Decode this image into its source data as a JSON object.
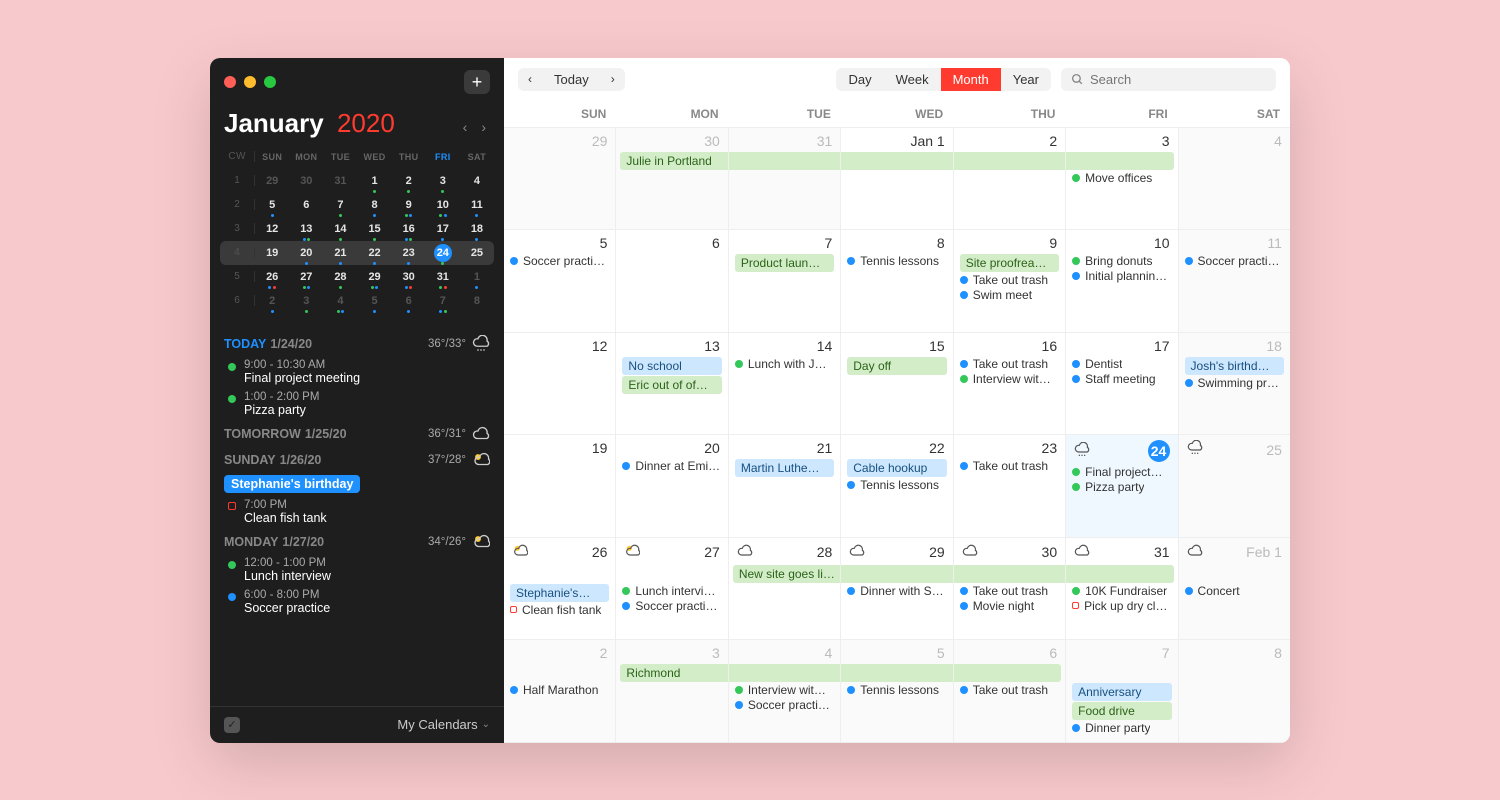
{
  "colors": {
    "green": "#34c759",
    "blue": "#1e90ff",
    "red": "#ff3b30"
  },
  "sidebar": {
    "month": "January",
    "year": "2020",
    "add_label": "+",
    "mini": {
      "head": [
        "CW",
        "SUN",
        "MON",
        "TUE",
        "WED",
        "THU",
        "FRI",
        "SAT"
      ],
      "today_col": 6,
      "rows": [
        {
          "cw": "1",
          "today": false,
          "days": [
            {
              "n": "29",
              "other": true
            },
            {
              "n": "30",
              "other": true
            },
            {
              "n": "31",
              "other": true
            },
            {
              "n": "1",
              "dots": [
                "green"
              ]
            },
            {
              "n": "2",
              "dots": [
                "green"
              ]
            },
            {
              "n": "3",
              "dots": [
                "green"
              ]
            },
            {
              "n": "4"
            }
          ]
        },
        {
          "cw": "2",
          "today": false,
          "days": [
            {
              "n": "5",
              "dots": [
                "blue"
              ]
            },
            {
              "n": "6"
            },
            {
              "n": "7",
              "dots": [
                "green"
              ]
            },
            {
              "n": "8",
              "dots": [
                "blue"
              ]
            },
            {
              "n": "9",
              "dots": [
                "green",
                "blue"
              ]
            },
            {
              "n": "10",
              "dots": [
                "green",
                "blue"
              ]
            },
            {
              "n": "11",
              "dots": [
                "blue"
              ]
            }
          ]
        },
        {
          "cw": "3",
          "today": false,
          "days": [
            {
              "n": "12"
            },
            {
              "n": "13",
              "dots": [
                "blue",
                "green"
              ]
            },
            {
              "n": "14",
              "dots": [
                "green"
              ]
            },
            {
              "n": "15",
              "dots": [
                "green"
              ]
            },
            {
              "n": "16",
              "dots": [
                "blue",
                "green"
              ]
            },
            {
              "n": "17",
              "dots": [
                "blue"
              ]
            },
            {
              "n": "18",
              "dots": [
                "blue"
              ]
            }
          ]
        },
        {
          "cw": "4",
          "today": true,
          "days": [
            {
              "n": "19"
            },
            {
              "n": "20",
              "dots": [
                "blue"
              ]
            },
            {
              "n": "21",
              "dots": [
                "blue"
              ]
            },
            {
              "n": "22",
              "dots": [
                "blue"
              ]
            },
            {
              "n": "23",
              "dots": [
                "blue"
              ]
            },
            {
              "n": "24",
              "today": true,
              "dots": [
                "green"
              ]
            },
            {
              "n": "25"
            }
          ]
        },
        {
          "cw": "5",
          "today": false,
          "days": [
            {
              "n": "26",
              "dots": [
                "blue",
                "red"
              ]
            },
            {
              "n": "27",
              "dots": [
                "green",
                "blue"
              ]
            },
            {
              "n": "28",
              "dots": [
                "green"
              ]
            },
            {
              "n": "29",
              "dots": [
                "green",
                "blue"
              ]
            },
            {
              "n": "30",
              "dots": [
                "blue",
                "red"
              ]
            },
            {
              "n": "31",
              "dots": [
                "green",
                "red"
              ]
            },
            {
              "n": "1",
              "other": true,
              "dots": [
                "blue"
              ]
            }
          ]
        },
        {
          "cw": "6",
          "today": false,
          "days": [
            {
              "n": "2",
              "other": true,
              "dots": [
                "blue"
              ]
            },
            {
              "n": "3",
              "other": true,
              "dots": [
                "green"
              ]
            },
            {
              "n": "4",
              "other": true,
              "dots": [
                "green",
                "blue"
              ]
            },
            {
              "n": "5",
              "other": true,
              "dots": [
                "blue"
              ]
            },
            {
              "n": "6",
              "other": true,
              "dots": [
                "blue"
              ]
            },
            {
              "n": "7",
              "other": true,
              "dots": [
                "blue",
                "green"
              ]
            },
            {
              "n": "8",
              "other": true
            }
          ]
        }
      ]
    },
    "agenda": [
      {
        "label": "TODAY",
        "date": "1/24/20",
        "today": true,
        "temp": "36°/33°",
        "wx": "rain",
        "items": [
          {
            "kind": "dot",
            "color": "green",
            "time": "9:00 - 10:30 AM",
            "title": "Final project meeting"
          },
          {
            "kind": "dot",
            "color": "green",
            "time": "1:00 - 2:00 PM",
            "title": "Pizza party"
          }
        ]
      },
      {
        "label": "TOMORROW",
        "date": "1/25/20",
        "temp": "36°/31°",
        "wx": "cloud",
        "items": []
      },
      {
        "label": "SUNDAY",
        "date": "1/26/20",
        "temp": "37°/28°",
        "wx": "partly",
        "items": [
          {
            "kind": "chip",
            "color": "blue",
            "title": "Stephanie's birthday"
          },
          {
            "kind": "sq",
            "color": "red",
            "time": "7:00 PM",
            "title": "Clean fish tank"
          }
        ]
      },
      {
        "label": "MONDAY",
        "date": "1/27/20",
        "temp": "34°/26°",
        "wx": "partly",
        "items": [
          {
            "kind": "dot",
            "color": "green",
            "time": "12:00 - 1:00 PM",
            "title": "Lunch interview"
          },
          {
            "kind": "dot",
            "color": "blue",
            "time": "6:00 - 8:00 PM",
            "title": "Soccer practice"
          }
        ]
      }
    ],
    "footer_label": "My Calendars"
  },
  "toolbar": {
    "today": "Today",
    "views": [
      "Day",
      "Week",
      "Month",
      "Year"
    ],
    "active_view": 2,
    "search_placeholder": "Search"
  },
  "dow": [
    "SUN",
    "MON",
    "TUE",
    "WED",
    "THU",
    "FRI",
    "SAT"
  ],
  "weeks": [
    [
      {
        "num": "29",
        "other": true
      },
      {
        "num": "30",
        "other": true,
        "banner": {
          "text": "Julie in Portland",
          "color": "green",
          "pos": "start"
        }
      },
      {
        "num": "31",
        "other": true,
        "banner": {
          "text": "",
          "color": "green",
          "pos": "span"
        }
      },
      {
        "num": "Jan 1",
        "banner": {
          "text": "",
          "color": "green",
          "pos": "span"
        }
      },
      {
        "num": "2",
        "banner": {
          "text": "",
          "color": "green",
          "pos": "span"
        }
      },
      {
        "num": "3",
        "banner": {
          "text": "",
          "color": "green",
          "pos": "end"
        },
        "events": [
          {
            "k": "dot",
            "c": "green",
            "t": "Move offices"
          }
        ]
      },
      {
        "num": "4",
        "other": true
      }
    ],
    [
      {
        "num": "5",
        "events": [
          {
            "k": "dot",
            "c": "blue",
            "t": "Soccer practi…"
          }
        ]
      },
      {
        "num": "6"
      },
      {
        "num": "7",
        "events": [
          {
            "k": "banner",
            "c": "green",
            "t": "Product laun…"
          }
        ]
      },
      {
        "num": "8",
        "events": [
          {
            "k": "dot",
            "c": "blue",
            "t": "Tennis lessons"
          }
        ]
      },
      {
        "num": "9",
        "events": [
          {
            "k": "banner",
            "c": "green",
            "t": "Site proofrea…"
          },
          {
            "k": "dot",
            "c": "blue",
            "t": "Take out trash"
          },
          {
            "k": "dot",
            "c": "blue",
            "t": "Swim meet"
          }
        ]
      },
      {
        "num": "10",
        "events": [
          {
            "k": "dot",
            "c": "green",
            "t": "Bring donuts"
          },
          {
            "k": "dot",
            "c": "blue",
            "t": "Initial plannin…"
          }
        ]
      },
      {
        "num": "11",
        "other": true,
        "events": [
          {
            "k": "dot",
            "c": "blue",
            "t": "Soccer practi…"
          }
        ]
      }
    ],
    [
      {
        "num": "12"
      },
      {
        "num": "13",
        "events": [
          {
            "k": "banner",
            "c": "blue",
            "t": "No school"
          },
          {
            "k": "banner",
            "c": "green",
            "t": "Eric out of of…"
          }
        ]
      },
      {
        "num": "14",
        "events": [
          {
            "k": "dot",
            "c": "green",
            "t": "Lunch with J…"
          }
        ]
      },
      {
        "num": "15",
        "events": [
          {
            "k": "banner",
            "c": "green",
            "t": "Day off"
          }
        ]
      },
      {
        "num": "16",
        "events": [
          {
            "k": "dot",
            "c": "blue",
            "t": "Take out trash"
          },
          {
            "k": "dot",
            "c": "green",
            "t": "Interview wit…"
          }
        ]
      },
      {
        "num": "17",
        "events": [
          {
            "k": "dot",
            "c": "blue",
            "t": "Dentist"
          },
          {
            "k": "dot",
            "c": "blue",
            "t": "Staff meeting"
          }
        ]
      },
      {
        "num": "18",
        "other": true,
        "events": [
          {
            "k": "banner",
            "c": "blue",
            "t": "Josh's birthd…"
          },
          {
            "k": "dot",
            "c": "blue",
            "t": "Swimming pr…"
          }
        ]
      }
    ],
    [
      {
        "num": "19"
      },
      {
        "num": "20",
        "events": [
          {
            "k": "dot",
            "c": "blue",
            "t": "Dinner at Emi…"
          }
        ]
      },
      {
        "num": "21",
        "events": [
          {
            "k": "banner",
            "c": "blue",
            "t": "Martin Luthe…"
          }
        ]
      },
      {
        "num": "22",
        "events": [
          {
            "k": "banner",
            "c": "blue",
            "t": "Cable hookup"
          },
          {
            "k": "dot",
            "c": "blue",
            "t": "Tennis lessons"
          }
        ]
      },
      {
        "num": "23",
        "events": [
          {
            "k": "dot",
            "c": "blue",
            "t": "Take out trash"
          }
        ]
      },
      {
        "num": "24",
        "today": true,
        "wx": "rain",
        "events": [
          {
            "k": "dot",
            "c": "green",
            "t": "Final project…"
          },
          {
            "k": "dot",
            "c": "green",
            "t": "Pizza party"
          }
        ]
      },
      {
        "num": "25",
        "other": true,
        "wx": "rain"
      }
    ],
    [
      {
        "num": "26",
        "wx": "partly",
        "events": [
          {
            "k": "banner",
            "c": "blue",
            "t": "Stephanie's…"
          },
          {
            "k": "sq",
            "c": "red",
            "t": "Clean fish tank"
          }
        ]
      },
      {
        "num": "27",
        "wx": "partly",
        "events": [
          {
            "k": "dot",
            "c": "green",
            "t": "Lunch intervi…"
          },
          {
            "k": "dot",
            "c": "blue",
            "t": "Soccer practi…"
          }
        ]
      },
      {
        "num": "28",
        "wx": "cloud",
        "banner": {
          "text": "New site goes live",
          "color": "green",
          "pos": "start"
        }
      },
      {
        "num": "29",
        "wx": "cloud",
        "banner": {
          "text": "",
          "color": "green",
          "pos": "span"
        },
        "events": [
          {
            "k": "dot",
            "c": "blue",
            "t": "Dinner with S…"
          }
        ]
      },
      {
        "num": "30",
        "wx": "cloud",
        "banner": {
          "text": "",
          "color": "green",
          "pos": "span"
        },
        "events": [
          {
            "k": "dot",
            "c": "blue",
            "t": "Take out trash"
          },
          {
            "k": "dot",
            "c": "blue",
            "t": "Movie night"
          }
        ]
      },
      {
        "num": "31",
        "wx": "cloud",
        "banner": {
          "text": "",
          "color": "green",
          "pos": "end"
        },
        "events": [
          {
            "k": "dot",
            "c": "green",
            "t": "10K Fundraiser"
          },
          {
            "k": "sq",
            "c": "red",
            "t": "Pick up dry cl…"
          }
        ]
      },
      {
        "num": "Feb 1",
        "other": true,
        "wx": "cloud",
        "events": [
          {
            "k": "dot",
            "c": "blue",
            "t": "Concert"
          }
        ]
      }
    ],
    [
      {
        "num": "2",
        "other": true,
        "events": [
          {
            "k": "dot",
            "c": "blue",
            "t": "Half Marathon"
          }
        ]
      },
      {
        "num": "3",
        "other": true,
        "banner": {
          "text": "Richmond",
          "color": "green",
          "pos": "start"
        }
      },
      {
        "num": "4",
        "other": true,
        "banner": {
          "text": "",
          "color": "green",
          "pos": "span"
        },
        "events": [
          {
            "k": "dot",
            "c": "green",
            "t": "Interview wit…"
          },
          {
            "k": "dot",
            "c": "blue",
            "t": "Soccer practi…"
          }
        ]
      },
      {
        "num": "5",
        "other": true,
        "banner": {
          "text": "",
          "color": "green",
          "pos": "span"
        },
        "events": [
          {
            "k": "dot",
            "c": "blue",
            "t": "Tennis lessons"
          }
        ]
      },
      {
        "num": "6",
        "other": true,
        "banner": {
          "text": "",
          "color": "green",
          "pos": "end"
        },
        "events": [
          {
            "k": "dot",
            "c": "blue",
            "t": "Take out trash"
          }
        ]
      },
      {
        "num": "7",
        "other": true,
        "events": [
          {
            "k": "banner",
            "c": "blue",
            "t": "Anniversary"
          },
          {
            "k": "banner",
            "c": "green",
            "t": "Food drive"
          },
          {
            "k": "dot",
            "c": "blue",
            "t": "Dinner party"
          }
        ]
      },
      {
        "num": "8",
        "other": true
      }
    ]
  ]
}
